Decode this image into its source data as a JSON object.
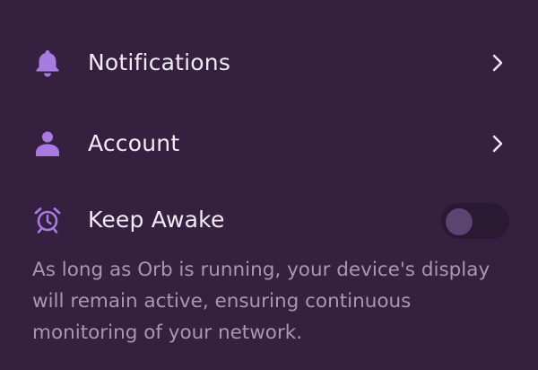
{
  "colors": {
    "background": "#352040",
    "accent": "#a77be0",
    "label": "#f1ebf6",
    "description": "#a698b4",
    "toggle_track": "#2a1932",
    "toggle_knob": "#5c4470"
  },
  "settings": {
    "notifications": {
      "label": "Notifications",
      "icon": "bell-icon"
    },
    "account": {
      "label": "Account",
      "icon": "person-icon"
    },
    "keep_awake": {
      "label": "Keep Awake",
      "icon": "alarm-clock-icon",
      "enabled": false,
      "description": "As long as Orb is running, your device's display will remain active, ensuring continuous monitoring of your network."
    }
  }
}
